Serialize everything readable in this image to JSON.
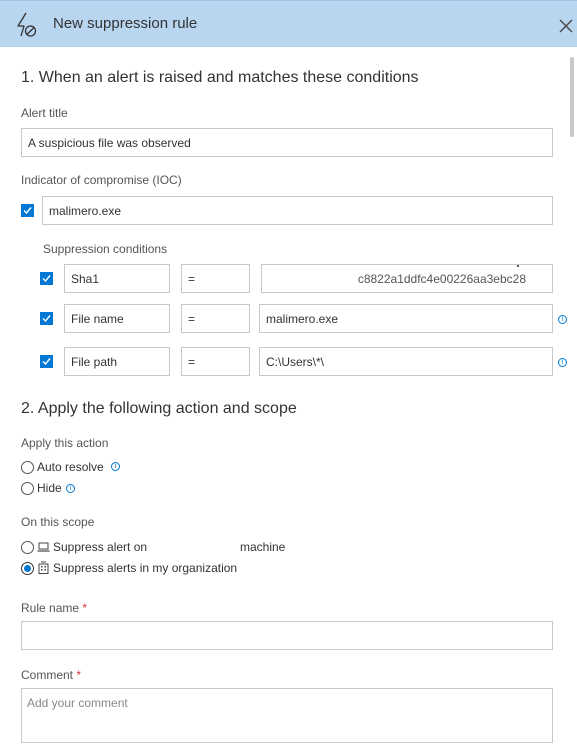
{
  "header": {
    "title": "New suppression rule"
  },
  "section1": {
    "heading": "1. When an alert is raised and matches these conditions",
    "alert_title_label": "Alert title",
    "alert_title_value": "A suspicious file was observed",
    "ioc_label": "Indicator of compromise (IOC)",
    "ioc_value": "malimero.exe",
    "suppression_conditions_label": "Suppression conditions",
    "conditions": [
      {
        "field": "Sha1",
        "operator": "=",
        "value": "c8822a1ddfc4e00226aa3ebc28"
      },
      {
        "field": "File name",
        "operator": "=",
        "value": "malimero.exe"
      },
      {
        "field": "File path",
        "operator": "=",
        "value": "C:\\Users\\*\\"
      }
    ]
  },
  "section2": {
    "heading": "2. Apply the following action and scope",
    "action_label": "Apply this action",
    "action_options": [
      "Auto resolve",
      "Hide"
    ],
    "scope_label": "On this scope",
    "scope_machine_prefix": "Suppress alert on",
    "scope_machine_suffix": "machine",
    "scope_org": "Suppress alerts in my organization",
    "rule_name_label": "Rule name",
    "comment_label": "Comment",
    "comment_placeholder": "Add your comment",
    "required_marker": "*"
  },
  "icons": {
    "header": "suppress-lightning-icon",
    "close": "close-icon",
    "info": "info-icon",
    "machine": "laptop-icon",
    "organization": "building-icon"
  },
  "colors": {
    "header_bg": "#b9d6f0",
    "accent": "#0078d4",
    "required": "#d13438"
  }
}
